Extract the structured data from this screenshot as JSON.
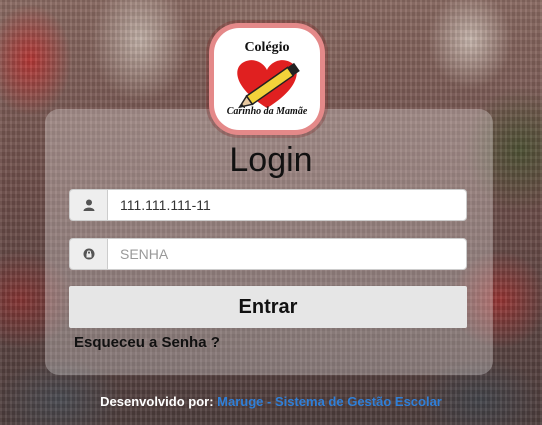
{
  "logo": {
    "top_text": "Colégio",
    "bottom_text": "Carinho da Mamãe",
    "icon": "heart-pencil-logo"
  },
  "login": {
    "title": "Login",
    "user_field": {
      "value": "111.111.111-11",
      "icon": "user-icon"
    },
    "password_field": {
      "placeholder": "SENHA",
      "value": "",
      "icon": "lock-icon"
    },
    "submit_label": "Entrar",
    "forgot_label": "Esqueceu a Senha ?"
  },
  "footer": {
    "prefix": "Desenvolvido por:",
    "link_text": "Maruge - Sistema de Gestão Escolar"
  },
  "colors": {
    "footer_link": "#2f7fd8",
    "logo_heart": "#e02020"
  }
}
